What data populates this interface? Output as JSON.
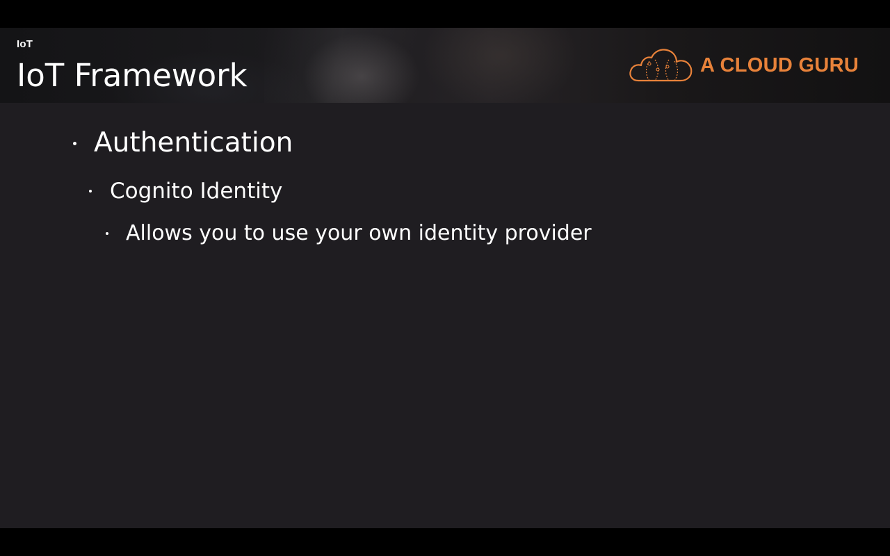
{
  "header": {
    "section_label": "IoT",
    "title": "IoT Framework"
  },
  "logo": {
    "text": "A CLOUD GURU",
    "icon": "cloud-guru-icon",
    "color": "#e8823a"
  },
  "bullets": [
    {
      "level": 1,
      "text": "Authentication"
    },
    {
      "level": 2,
      "text": "Cognito Identity"
    },
    {
      "level": 3,
      "text": "Allows you to use your own identity provider"
    }
  ],
  "colors": {
    "slide_background": "#1f1d21",
    "letterbox": "#000000",
    "text": "#ffffff",
    "accent": "#e8823a"
  }
}
